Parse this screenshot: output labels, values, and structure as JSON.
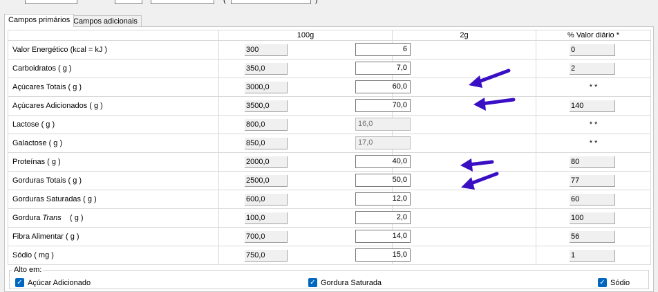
{
  "tabs": [
    {
      "label": "Campos primários",
      "active": true
    },
    {
      "label": "Campos adicionais",
      "active": false
    }
  ],
  "top": {
    "paren_open": "(",
    "paren_close": ")"
  },
  "columns": {
    "label": "",
    "col100g": "100g",
    "col2g": "2g",
    "vd": "% Valor diário *"
  },
  "rows": [
    {
      "label": "Valor Energético (kcal = kJ )",
      "v100": "300",
      "v2": "6",
      "vd": "0",
      "v2_disabled": false
    },
    {
      "label": "Carboidratos ( g )",
      "v100": "350,0",
      "v2": "7,0",
      "vd": "2",
      "v2_disabled": false
    },
    {
      "label": "Açúcares Totais ( g )",
      "v100": "3000,0",
      "v2": "60,0",
      "vd": "* *",
      "v2_disabled": false
    },
    {
      "label": "Açúcares Adicionados ( g )",
      "v100": "3500,0",
      "v2": "70,0",
      "vd": "140",
      "v2_disabled": false
    },
    {
      "label": "Lactose ( g )",
      "v100": "800,0",
      "v2": "16,0",
      "vd": "* *",
      "v2_disabled": true
    },
    {
      "label": "Galactose ( g )",
      "v100": "850,0",
      "v2": "17,0",
      "vd": "* *",
      "v2_disabled": true
    },
    {
      "label": "Proteínas ( g )",
      "v100": "2000,0",
      "v2": "40,0",
      "vd": "80",
      "v2_disabled": false
    },
    {
      "label": "Gorduras Totais ( g )",
      "v100": "2500,0",
      "v2": "50,0",
      "vd": "77",
      "v2_disabled": false
    },
    {
      "label": "Gorduras Saturadas ( g )",
      "v100": "600,0",
      "v2": "12,0",
      "vd": "60",
      "v2_disabled": false
    },
    {
      "label": "Gordura",
      "label_italic": "Trans",
      "label_suffix": "( g )",
      "v100": "100,0",
      "v2": "2,0",
      "vd": "100",
      "v2_disabled": false
    },
    {
      "label": "Fibra Alimentar ( g )",
      "v100": "700,0",
      "v2": "14,0",
      "vd": "56",
      "v2_disabled": false
    },
    {
      "label": "Sódio ( mg )",
      "v100": "750,0",
      "v2": "15,0",
      "vd": "1",
      "v2_disabled": false
    }
  ],
  "alto_em": {
    "title": "Alto em:",
    "items": [
      {
        "label": "Açúcar Adicionado",
        "checked": true
      },
      {
        "label": "Gordura Saturada",
        "checked": true
      },
      {
        "label": "Sódio",
        "checked": true
      }
    ]
  },
  "colors": {
    "accent": "#0067c0",
    "arrow": "#3a0fc4"
  }
}
